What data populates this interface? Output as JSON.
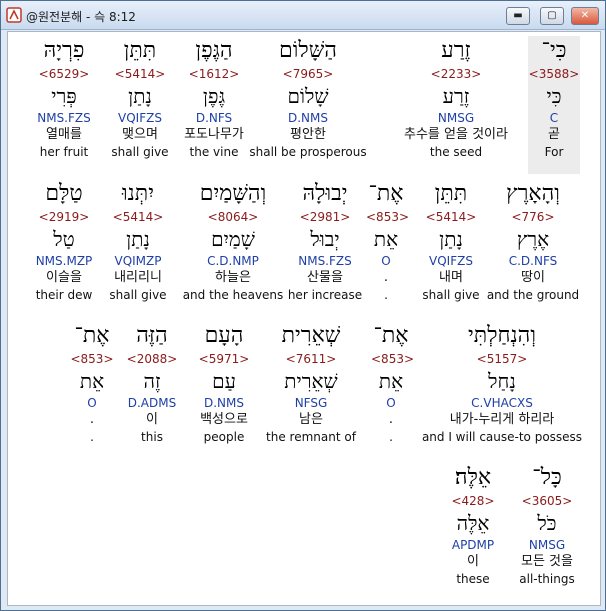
{
  "window": {
    "title": "@원전분해 - 슥 8:12",
    "min_icon": "minimize-icon",
    "max_icon": "maximize-icon",
    "close_icon": "close-icon",
    "close_glyph": "✕",
    "min_glyph": "▬",
    "max_glyph": "▢"
  },
  "rows": [
    {
      "words": [
        {
          "heb": "פִרְיָהּ",
          "strong": "<6529>",
          "lemma": "פְּרִי",
          "morph": "NMS.FZS",
          "kor": "열매를",
          "eng": "her fruit"
        },
        {
          "heb": "תִּתֵּן",
          "strong": "<5414>",
          "lemma": "נָתַן",
          "morph": "VQIFZS",
          "kor": "맺으며",
          "eng": "shall give"
        },
        {
          "heb": "הַגֶּפֶן",
          "strong": "<1612>",
          "lemma": "גֶּפֶן",
          "morph": "D.NFS",
          "kor": "포도나무가",
          "eng": "the vine"
        },
        {
          "heb": "הַשָּׁלוֹם",
          "strong": "<7965>",
          "lemma": "שָׁלוֹם",
          "morph": "D.NMS",
          "kor": "평안한",
          "eng": "shall be prosperous"
        },
        {
          "heb": "זֶרַע",
          "strong": "<2233>",
          "lemma": "זֶרַע",
          "morph": "NMSG",
          "kor": "추수를 얻을 것이라",
          "eng": "the seed"
        },
        {
          "heb": "כִּי־",
          "strong": "<3588>",
          "lemma": "כִּי",
          "morph": "C",
          "kor": "곧",
          "eng": "For"
        }
      ]
    },
    {
      "words": [
        {
          "heb": "טַלָּם",
          "strong": "<2919>",
          "lemma": "טַל",
          "morph": "NMS.MZP",
          "kor": "이슬을",
          "eng": "their dew"
        },
        {
          "heb": "יִתְּנוּ",
          "strong": "<5414>",
          "lemma": "נָתַן",
          "morph": "VQIMZP",
          "kor": "내리리니",
          "eng": "shall give"
        },
        {
          "heb": "וְהַשָּׁמַיִם",
          "strong": "<8064>",
          "lemma": "שָׁמַיִם",
          "morph": "C.D.NMP",
          "kor": "하늘은",
          "eng": "and the heavens"
        },
        {
          "heb": "יְבוּלָהּ",
          "strong": "<2981>",
          "lemma": "יְבוּל",
          "morph": "NMS.FZS",
          "kor": "산물을",
          "eng": "her increase"
        },
        {
          "heb": "אֶת־",
          "strong": "<853>",
          "lemma": "אֵת",
          "morph": "O",
          "kor": ".",
          "eng": "."
        },
        {
          "heb": "תִּתֵּן",
          "strong": "<5414>",
          "lemma": "נָתַן",
          "morph": "VQIFZS",
          "kor": "내며",
          "eng": "shall give"
        },
        {
          "heb": "וְהָאָרֶץ",
          "strong": "<776>",
          "lemma": "אֶרֶץ",
          "morph": "C.D.NFS",
          "kor": "땅이",
          "eng": "and the ground"
        }
      ]
    },
    {
      "words": [
        {
          "heb": "אֶת־",
          "strong": "<853>",
          "lemma": "אֵת",
          "morph": "O",
          "kor": ".",
          "eng": "."
        },
        {
          "heb": "הַזֶּה",
          "strong": "<2088>",
          "lemma": "זֶה",
          "morph": "D.ADMS",
          "kor": "이",
          "eng": "this"
        },
        {
          "heb": "הָעָם",
          "strong": "<5971>",
          "lemma": "עַם",
          "morph": "D.NMS",
          "kor": "백성으로",
          "eng": "people"
        },
        {
          "heb": "שְׁאֵרִית",
          "strong": "<7611>",
          "lemma": "שְׁאֵרִית",
          "morph": "NFSG",
          "kor": "남은",
          "eng": "the remnant of"
        },
        {
          "heb": "אֶת־",
          "strong": "<853>",
          "lemma": "אֵת",
          "morph": "O",
          "kor": ".",
          "eng": "."
        },
        {
          "heb": "וְהִנְחַלְתִּי",
          "strong": "<5157>",
          "lemma": "נָחַל",
          "morph": "C.VHACXS",
          "kor": "내가-누리게 하리라",
          "eng": "and I will cause-to possess"
        }
      ]
    },
    {
      "words": [
        {
          "heb": "אֵלֶּה׃",
          "strong": "<428>",
          "lemma": "אֵלֶּה",
          "morph": "APDMP",
          "kor": "이",
          "eng": "these"
        },
        {
          "heb": "כָּל־",
          "strong": "<3605>",
          "lemma": "כֹּל",
          "morph": "NMSG",
          "kor": "모든 것을",
          "eng": "all-things"
        }
      ]
    }
  ]
}
